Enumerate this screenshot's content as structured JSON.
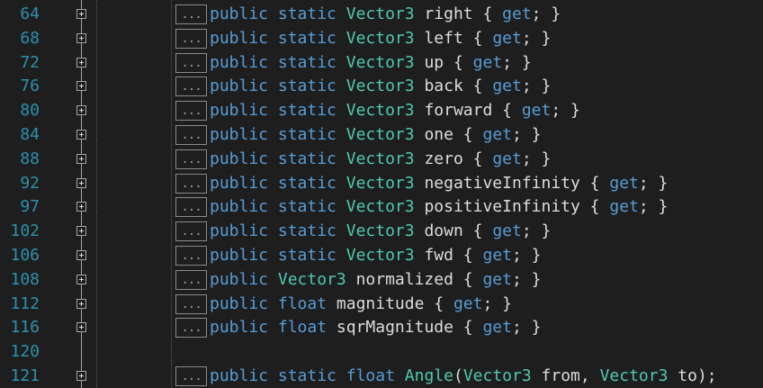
{
  "colors": {
    "background": "#1e1e1e",
    "line_number": "#2b91af",
    "keyword": "#569cd6",
    "type": "#4ec9b0",
    "identifier": "#dcdcdc",
    "fold_box": "#a5a5a5"
  },
  "icons": {
    "fold": "expand-plus-icon",
    "collapsed_region": "ellipsis-box"
  },
  "lines": [
    {
      "num": "64",
      "has_fold": true,
      "collapsed": "...",
      "tokens": [
        [
          "kw",
          "public"
        ],
        [
          "pn",
          " "
        ],
        [
          "kw",
          "static"
        ],
        [
          "pn",
          " "
        ],
        [
          "ty",
          "Vector3"
        ],
        [
          "pn",
          " "
        ],
        [
          "id",
          "right"
        ],
        [
          "pn",
          " { "
        ],
        [
          "kw",
          "get"
        ],
        [
          "pn",
          "; }"
        ]
      ]
    },
    {
      "num": "68",
      "has_fold": true,
      "collapsed": "...",
      "tokens": [
        [
          "kw",
          "public"
        ],
        [
          "pn",
          " "
        ],
        [
          "kw",
          "static"
        ],
        [
          "pn",
          " "
        ],
        [
          "ty",
          "Vector3"
        ],
        [
          "pn",
          " "
        ],
        [
          "id",
          "left"
        ],
        [
          "pn",
          " { "
        ],
        [
          "kw",
          "get"
        ],
        [
          "pn",
          "; }"
        ]
      ]
    },
    {
      "num": "72",
      "has_fold": true,
      "collapsed": "...",
      "tokens": [
        [
          "kw",
          "public"
        ],
        [
          "pn",
          " "
        ],
        [
          "kw",
          "static"
        ],
        [
          "pn",
          " "
        ],
        [
          "ty",
          "Vector3"
        ],
        [
          "pn",
          " "
        ],
        [
          "id",
          "up"
        ],
        [
          "pn",
          " { "
        ],
        [
          "kw",
          "get"
        ],
        [
          "pn",
          "; }"
        ]
      ]
    },
    {
      "num": "76",
      "has_fold": true,
      "collapsed": "...",
      "tokens": [
        [
          "kw",
          "public"
        ],
        [
          "pn",
          " "
        ],
        [
          "kw",
          "static"
        ],
        [
          "pn",
          " "
        ],
        [
          "ty",
          "Vector3"
        ],
        [
          "pn",
          " "
        ],
        [
          "id",
          "back"
        ],
        [
          "pn",
          " { "
        ],
        [
          "kw",
          "get"
        ],
        [
          "pn",
          "; }"
        ]
      ]
    },
    {
      "num": "80",
      "has_fold": true,
      "collapsed": "...",
      "tokens": [
        [
          "kw",
          "public"
        ],
        [
          "pn",
          " "
        ],
        [
          "kw",
          "static"
        ],
        [
          "pn",
          " "
        ],
        [
          "ty",
          "Vector3"
        ],
        [
          "pn",
          " "
        ],
        [
          "id",
          "forward"
        ],
        [
          "pn",
          " { "
        ],
        [
          "kw",
          "get"
        ],
        [
          "pn",
          "; }"
        ]
      ]
    },
    {
      "num": "84",
      "has_fold": true,
      "collapsed": "...",
      "tokens": [
        [
          "kw",
          "public"
        ],
        [
          "pn",
          " "
        ],
        [
          "kw",
          "static"
        ],
        [
          "pn",
          " "
        ],
        [
          "ty",
          "Vector3"
        ],
        [
          "pn",
          " "
        ],
        [
          "id",
          "one"
        ],
        [
          "pn",
          " { "
        ],
        [
          "kw",
          "get"
        ],
        [
          "pn",
          "; }"
        ]
      ]
    },
    {
      "num": "88",
      "has_fold": true,
      "collapsed": "...",
      "tokens": [
        [
          "kw",
          "public"
        ],
        [
          "pn",
          " "
        ],
        [
          "kw",
          "static"
        ],
        [
          "pn",
          " "
        ],
        [
          "ty",
          "Vector3"
        ],
        [
          "pn",
          " "
        ],
        [
          "id",
          "zero"
        ],
        [
          "pn",
          " { "
        ],
        [
          "kw",
          "get"
        ],
        [
          "pn",
          "; }"
        ]
      ]
    },
    {
      "num": "92",
      "has_fold": true,
      "collapsed": "...",
      "tokens": [
        [
          "kw",
          "public"
        ],
        [
          "pn",
          " "
        ],
        [
          "kw",
          "static"
        ],
        [
          "pn",
          " "
        ],
        [
          "ty",
          "Vector3"
        ],
        [
          "pn",
          " "
        ],
        [
          "id",
          "negativeInfinity"
        ],
        [
          "pn",
          " { "
        ],
        [
          "kw",
          "get"
        ],
        [
          "pn",
          "; }"
        ]
      ]
    },
    {
      "num": "97",
      "has_fold": true,
      "collapsed": "...",
      "tokens": [
        [
          "kw",
          "public"
        ],
        [
          "pn",
          " "
        ],
        [
          "kw",
          "static"
        ],
        [
          "pn",
          " "
        ],
        [
          "ty",
          "Vector3"
        ],
        [
          "pn",
          " "
        ],
        [
          "id",
          "positiveInfinity"
        ],
        [
          "pn",
          " { "
        ],
        [
          "kw",
          "get"
        ],
        [
          "pn",
          "; }"
        ]
      ]
    },
    {
      "num": "102",
      "has_fold": true,
      "collapsed": "...",
      "tokens": [
        [
          "kw",
          "public"
        ],
        [
          "pn",
          " "
        ],
        [
          "kw",
          "static"
        ],
        [
          "pn",
          " "
        ],
        [
          "ty",
          "Vector3"
        ],
        [
          "pn",
          " "
        ],
        [
          "id",
          "down"
        ],
        [
          "pn",
          " { "
        ],
        [
          "kw",
          "get"
        ],
        [
          "pn",
          "; }"
        ]
      ]
    },
    {
      "num": "106",
      "has_fold": true,
      "collapsed": "...",
      "tokens": [
        [
          "kw",
          "public"
        ],
        [
          "pn",
          " "
        ],
        [
          "kw",
          "static"
        ],
        [
          "pn",
          " "
        ],
        [
          "ty",
          "Vector3"
        ],
        [
          "pn",
          " "
        ],
        [
          "id",
          "fwd"
        ],
        [
          "pn",
          " { "
        ],
        [
          "kw",
          "get"
        ],
        [
          "pn",
          "; }"
        ]
      ]
    },
    {
      "num": "108",
      "has_fold": true,
      "collapsed": "...",
      "tokens": [
        [
          "kw",
          "public"
        ],
        [
          "pn",
          " "
        ],
        [
          "ty",
          "Vector3"
        ],
        [
          "pn",
          " "
        ],
        [
          "id",
          "normalized"
        ],
        [
          "pn",
          " { "
        ],
        [
          "kw",
          "get"
        ],
        [
          "pn",
          "; }"
        ]
      ]
    },
    {
      "num": "112",
      "has_fold": true,
      "collapsed": "...",
      "tokens": [
        [
          "kw",
          "public"
        ],
        [
          "pn",
          " "
        ],
        [
          "kw",
          "float"
        ],
        [
          "pn",
          " "
        ],
        [
          "id",
          "magnitude"
        ],
        [
          "pn",
          " { "
        ],
        [
          "kw",
          "get"
        ],
        [
          "pn",
          "; }"
        ]
      ]
    },
    {
      "num": "116",
      "has_fold": true,
      "collapsed": "...",
      "tokens": [
        [
          "kw",
          "public"
        ],
        [
          "pn",
          " "
        ],
        [
          "kw",
          "float"
        ],
        [
          "pn",
          " "
        ],
        [
          "id",
          "sqrMagnitude"
        ],
        [
          "pn",
          " { "
        ],
        [
          "kw",
          "get"
        ],
        [
          "pn",
          "; }"
        ]
      ]
    },
    {
      "num": "120",
      "has_fold": false,
      "collapsed": "",
      "tokens": []
    },
    {
      "num": "121",
      "has_fold": true,
      "collapsed": "...",
      "tokens": [
        [
          "kw",
          "public"
        ],
        [
          "pn",
          " "
        ],
        [
          "kw",
          "static"
        ],
        [
          "pn",
          " "
        ],
        [
          "kw",
          "float"
        ],
        [
          "pn",
          " "
        ],
        [
          "ty",
          "Angle"
        ],
        [
          "pn",
          "("
        ],
        [
          "ty",
          "Vector3"
        ],
        [
          "pn",
          " "
        ],
        [
          "id",
          "from"
        ],
        [
          "pn",
          ", "
        ],
        [
          "ty",
          "Vector3"
        ],
        [
          "pn",
          " "
        ],
        [
          "id",
          "to"
        ],
        [
          "pn",
          ");"
        ]
      ]
    }
  ]
}
